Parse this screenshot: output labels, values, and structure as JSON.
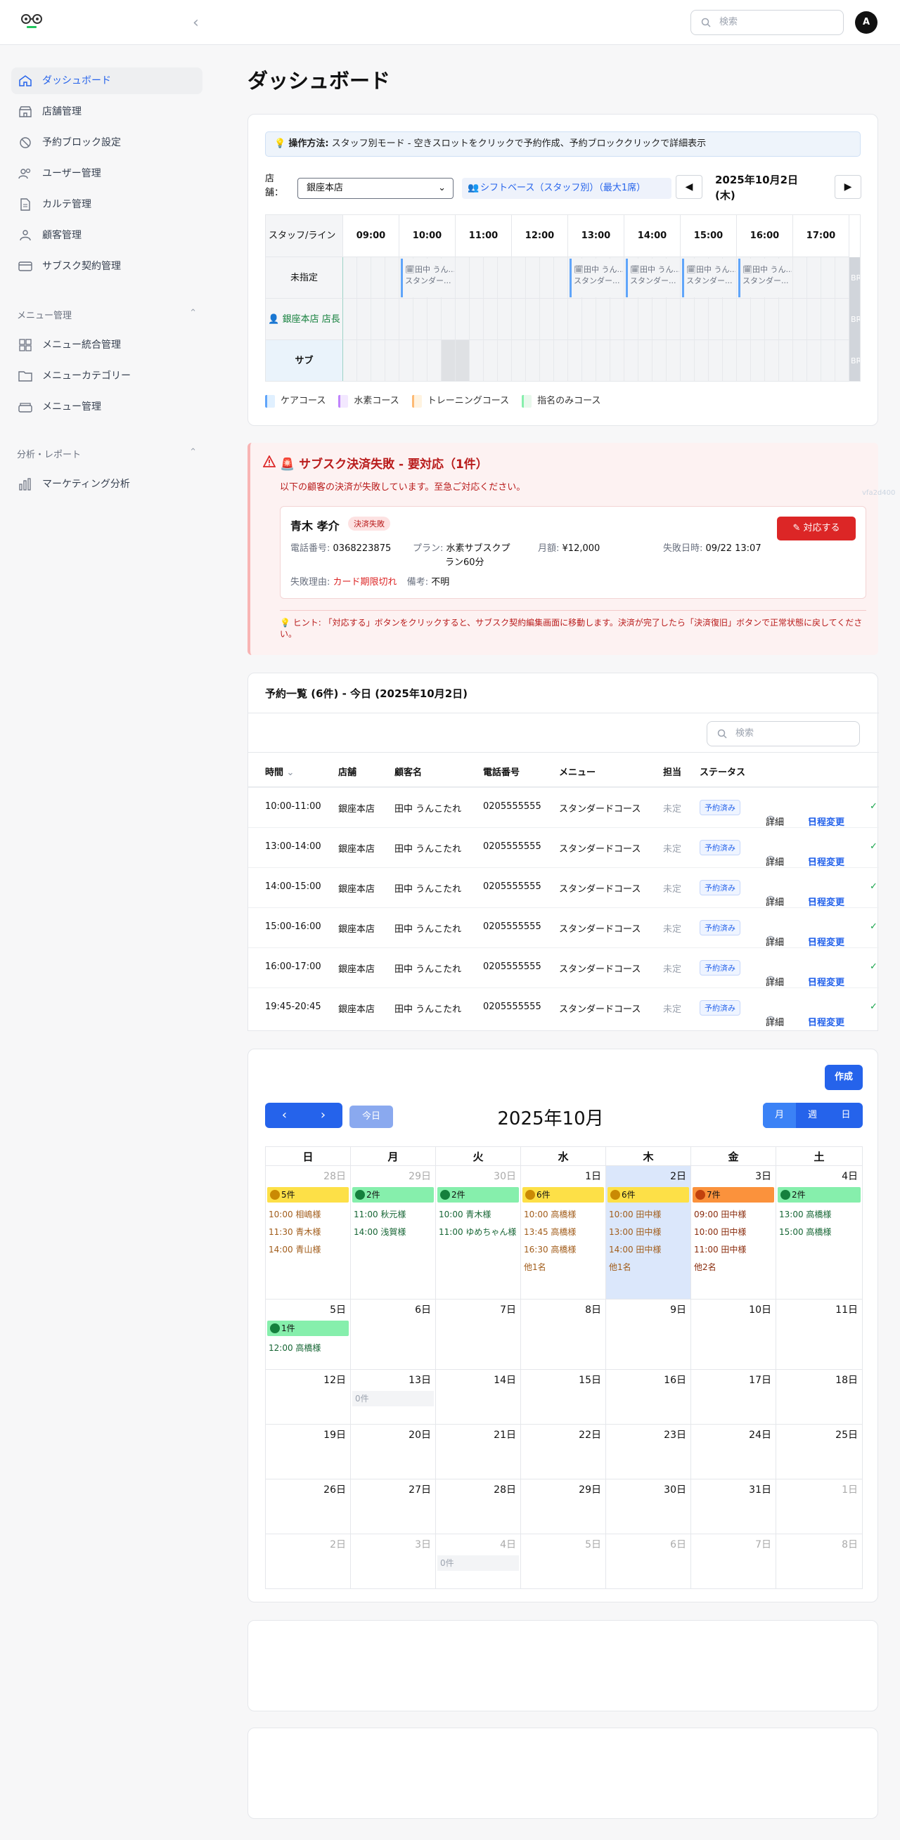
{
  "header": {
    "search_placeholder": "検索",
    "avatar_initial": "A"
  },
  "sidebar": {
    "items": [
      {
        "label": "ダッシュボード"
      },
      {
        "label": "店舗管理"
      },
      {
        "label": "予約ブロック設定"
      },
      {
        "label": "ユーザー管理"
      },
      {
        "label": "カルテ管理"
      },
      {
        "label": "顧客管理"
      },
      {
        "label": "サブスク契約管理"
      }
    ],
    "menu_section": {
      "title": "メニュー管理",
      "items": [
        {
          "label": "メニュー統合管理"
        },
        {
          "label": "メニューカテゴリー"
        },
        {
          "label": "メニュー管理"
        }
      ]
    },
    "analytics_section": {
      "title": "分析・レポート",
      "items": [
        {
          "label": "マーケティング分析"
        }
      ]
    }
  },
  "page": {
    "title": "ダッシュボード"
  },
  "schedule": {
    "hint_bold": "操作方法:",
    "hint_text": "スタッフ別モード - 空きスロットをクリックで予約作成、予約ブロッククリックで詳細表示",
    "store_label": "店舗：",
    "store_value": "銀座本店",
    "mode_label": "シフトベース（スタッフ別）（最大1席）",
    "date_label": "2025年10月2日(木)",
    "prev": "◀",
    "next": "▶",
    "header_first": "スタッフ/ライン",
    "hours": [
      "09:00",
      "10:00",
      "11:00",
      "12:00",
      "13:00",
      "14:00",
      "15:00",
      "16:00",
      "17:00"
    ],
    "rows": [
      "未指定",
      "銀座本店 店長",
      "サブ"
    ],
    "block_line1": "田中 うん...",
    "block_line2": "スタンダー...",
    "br_label": "BR",
    "legend": [
      {
        "label": "ケアコース",
        "color": "#e0f0ff",
        "edge": "#60a5fa"
      },
      {
        "label": "水素コース",
        "color": "#f3e8ff",
        "edge": "#c084fc"
      },
      {
        "label": "トレーニングコース",
        "color": "#fff3e0",
        "edge": "#fdba74"
      },
      {
        "label": "指名のみコース",
        "color": "#e8f8ec",
        "edge": "#86efac"
      }
    ]
  },
  "alert": {
    "title": "🚨 サブスク決済失敗 - 要対応（1件）",
    "subtitle": "以下の顧客の決済が失敗しています。至急ご対応ください。",
    "side_code": "vfa2d400",
    "customer_name": "青木 孝介",
    "status_badge": "決済失敗",
    "phone_label": "電話番号:",
    "phone": "0368223875",
    "plan_label": "プラン:",
    "plan_line1": "水素サブスクプ",
    "plan_line2": "ラン60分",
    "monthly_label": "月額:",
    "monthly": "¥12,000",
    "failed_at_label": "失敗日時:",
    "failed_at": "09/22 13:07",
    "reason_label": "失敗理由:",
    "reason": "カード期限切れ",
    "note_label": "備考:",
    "note": "不明",
    "action_button": "対応する",
    "tip": "💡 ヒント: 「対応する」ボタンをクリックすると、サブスク契約編集画面に移動します。決済が完了したら「決済復旧」ボタンで正常状態に戻してくださ",
    "tip_cont": "い。"
  },
  "reservations": {
    "title": "予約一覧 (6件) - 今日 (2025年10月2日)",
    "search_placeholder": "検索",
    "columns": [
      "時間",
      "店舗",
      "顧客名",
      "電話番号",
      "メニュー",
      "担当",
      "ステータス"
    ],
    "rows": [
      {
        "time": "10:00-11:00",
        "store": "銀座本店",
        "customer": "田中 うんこたれ",
        "phone": "0205555555",
        "menu": "スタンダードコース",
        "staff": "未定",
        "status": "予約済み"
      },
      {
        "time": "13:00-14:00",
        "store": "銀座本店",
        "customer": "田中 うんこたれ",
        "phone": "0205555555",
        "menu": "スタンダードコース",
        "staff": "未定",
        "status": "予約済み"
      },
      {
        "time": "14:00-15:00",
        "store": "銀座本店",
        "customer": "田中 うんこたれ",
        "phone": "0205555555",
        "menu": "スタンダードコース",
        "staff": "未定",
        "status": "予約済み"
      },
      {
        "time": "15:00-16:00",
        "store": "銀座本店",
        "customer": "田中 うんこたれ",
        "phone": "0205555555",
        "menu": "スタンダードコース",
        "staff": "未定",
        "status": "予約済み"
      },
      {
        "time": "16:00-17:00",
        "store": "銀座本店",
        "customer": "田中 うんこたれ",
        "phone": "0205555555",
        "menu": "スタンダードコース",
        "staff": "未定",
        "status": "予約済み"
      },
      {
        "time": "19:45-20:45",
        "store": "銀座本店",
        "customer": "田中 うんこたれ",
        "phone": "0205555555",
        "menu": "スタンダードコース",
        "staff": "未定",
        "status": "予約済み"
      }
    ],
    "detail_label": "詳細",
    "reschedule_label": "日程変更"
  },
  "calendar": {
    "create_button": "作成",
    "today_button": "今日",
    "month_title": "2025年10月",
    "views": [
      "月",
      "週",
      "日"
    ],
    "weekdays": [
      "日",
      "月",
      "火",
      "水",
      "木",
      "金",
      "土"
    ],
    "weeks": [
      [
        {
          "day": "28日",
          "dim": true,
          "count": "5件",
          "level": "yellow",
          "events": [
            "10:00 相嶋様",
            "11:30 青木様",
            "14:00 青山様"
          ]
        },
        {
          "day": "29日",
          "dim": true,
          "count": "2件",
          "level": "green",
          "events": [
            "11:00 秋元様",
            "14:00 浅賀様"
          ]
        },
        {
          "day": "30日",
          "dim": true,
          "count": "2件",
          "level": "green",
          "events": [
            "10:00 青木様",
            "11:00 ゆめちゃん様"
          ]
        },
        {
          "day": "1日",
          "count": "6件",
          "level": "yellow",
          "events": [
            "10:00 高橋様",
            "13:45 高橋様",
            "16:30 高橋様",
            "他1名"
          ]
        },
        {
          "day": "2日",
          "today": true,
          "count": "6件",
          "level": "yellow",
          "events": [
            "10:00 田中様",
            "13:00 田中様",
            "14:00 田中様",
            "他1名"
          ]
        },
        {
          "day": "3日",
          "count": "7件",
          "level": "orange",
          "events": [
            "09:00 田中様",
            "10:00 田中様",
            "11:00 田中様",
            "他2名"
          ]
        },
        {
          "day": "4日",
          "count": "2件",
          "level": "green",
          "events": [
            "13:00 高橋様",
            "15:00 高橋様"
          ]
        }
      ],
      [
        {
          "day": "5日",
          "count": "1件",
          "level": "green",
          "events": [
            "12:00 高橋様"
          ]
        },
        {
          "day": "6日"
        },
        {
          "day": "7日"
        },
        {
          "day": "8日"
        },
        {
          "day": "9日"
        },
        {
          "day": "10日"
        },
        {
          "day": "11日"
        }
      ],
      [
        {
          "day": "12日"
        },
        {
          "day": "13日",
          "zero": "0件"
        },
        {
          "day": "14日"
        },
        {
          "day": "15日"
        },
        {
          "day": "16日"
        },
        {
          "day": "17日"
        },
        {
          "day": "18日"
        }
      ],
      [
        {
          "day": "19日"
        },
        {
          "day": "20日"
        },
        {
          "day": "21日"
        },
        {
          "day": "22日"
        },
        {
          "day": "23日"
        },
        {
          "day": "24日"
        },
        {
          "day": "25日"
        }
      ],
      [
        {
          "day": "26日"
        },
        {
          "day": "27日"
        },
        {
          "day": "28日"
        },
        {
          "day": "29日"
        },
        {
          "day": "30日"
        },
        {
          "day": "31日"
        },
        {
          "day": "1日",
          "dim": true
        }
      ],
      [
        {
          "day": "2日",
          "dim": true
        },
        {
          "day": "3日",
          "dim": true
        },
        {
          "day": "4日",
          "dim": true,
          "zero": "0件"
        },
        {
          "day": "5日",
          "dim": true
        },
        {
          "day": "6日",
          "dim": true
        },
        {
          "day": "7日",
          "dim": true
        },
        {
          "day": "8日",
          "dim": true
        }
      ]
    ],
    "level_colors": {
      "yellow": "#fde047",
      "green": "#86efac",
      "orange": "#fb923c"
    },
    "event_colors": {
      "yellow": "#a15c1a",
      "green": "#166534",
      "orange": "#8a2c0d"
    }
  }
}
